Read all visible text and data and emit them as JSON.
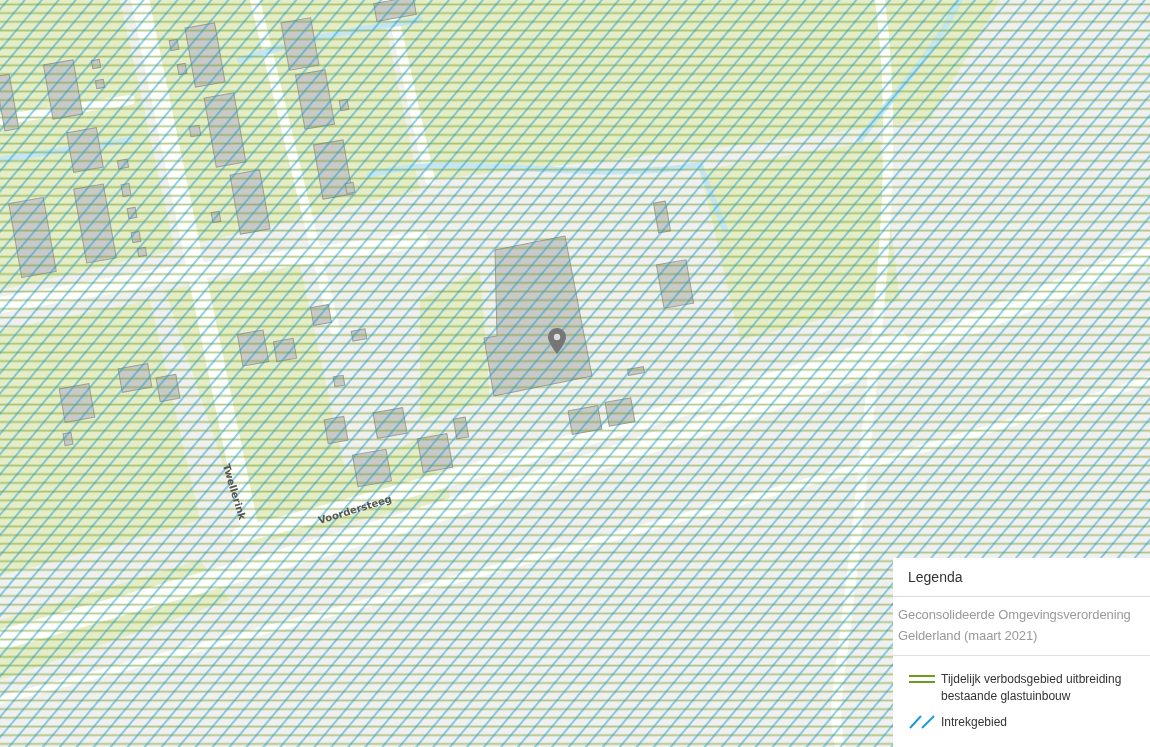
{
  "map": {
    "street_labels": [
      "Twellerink",
      "Voordersteeg"
    ]
  },
  "legend": {
    "title": "Legenda",
    "source": "Geconsolideerde Omgevingsverordening Gelderland (maart 2021)",
    "items": [
      {
        "kind": "double_line",
        "color": "#6b9c1f",
        "label": "Tijdelijk verbodsgebied uitbreiding bestaande glastuinbouw"
      },
      {
        "kind": "hatch",
        "color": "#1d9bd5",
        "label": "Intrekgebied"
      }
    ]
  }
}
